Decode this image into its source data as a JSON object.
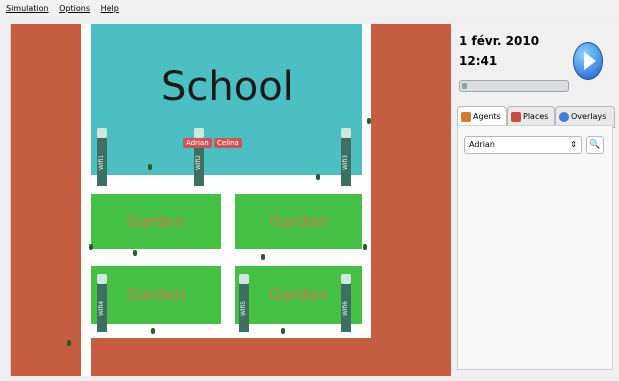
{
  "menu": {
    "items": [
      "Simulation",
      "Options",
      "Help"
    ]
  },
  "map": {
    "school_label": "School",
    "gardens": [
      {
        "label": "Garden"
      },
      {
        "label": "Garden"
      },
      {
        "label": "Garden"
      },
      {
        "label": "Garden"
      }
    ],
    "wifi": [
      "Wifi1",
      "Wifi2",
      "Wifi3",
      "Wifi4",
      "Wifi5",
      "Wifi6"
    ],
    "agents_tags": [
      "Adrian",
      "Celina"
    ]
  },
  "panel": {
    "date": "1 févr. 2010",
    "time": "12:41",
    "tabs": [
      {
        "label": "Agents",
        "icon": "person-icon",
        "active": true
      },
      {
        "label": "Places",
        "icon": "house-icon",
        "active": false
      },
      {
        "label": "Overlays",
        "icon": "globe-icon",
        "active": false
      }
    ],
    "agent_select": {
      "value": "Adrian"
    }
  }
}
